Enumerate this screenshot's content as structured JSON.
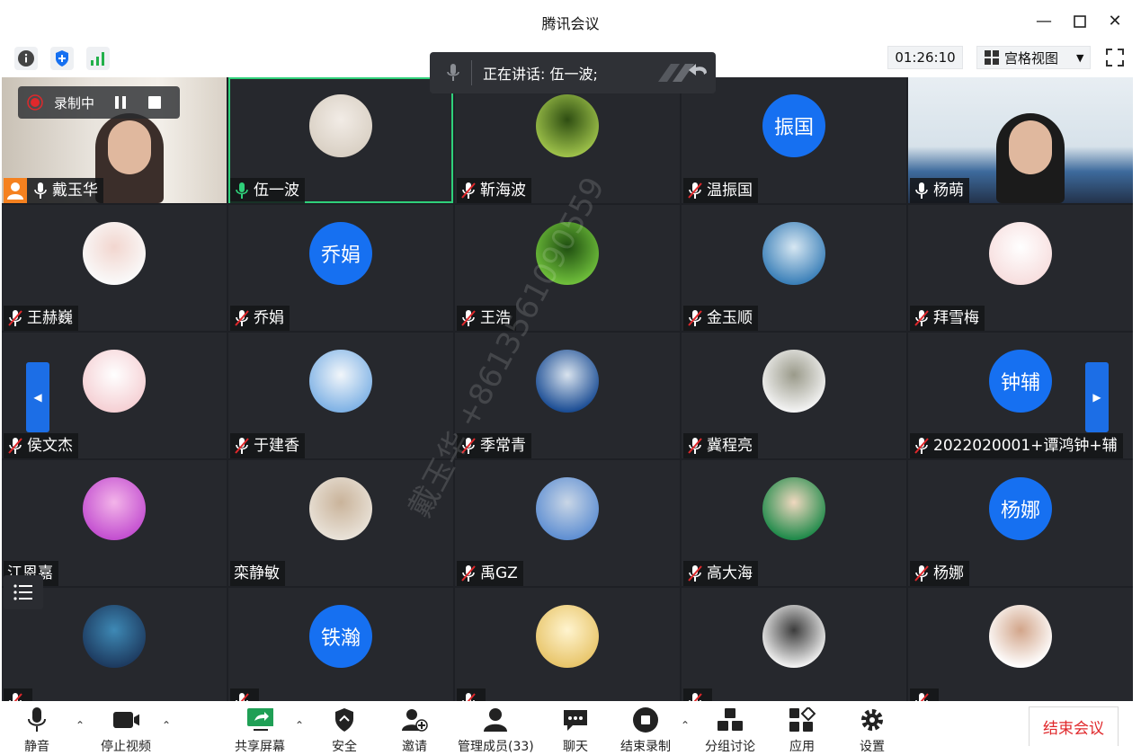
{
  "window": {
    "title": "腾讯会议"
  },
  "toolbar": {
    "timer": "01:26:10",
    "view_mode": "宫格视图"
  },
  "speaking_banner": {
    "text": "正在讲话: 伍一波;"
  },
  "recording": {
    "label": "录制中"
  },
  "watermark": "戴玉华 +8613561090559",
  "participants": [
    {
      "name": "戴玉华",
      "mic": "on"
    },
    {
      "name": "伍一波",
      "mic": "speaking"
    },
    {
      "name": "靳海波",
      "mic": "muted"
    },
    {
      "name": "温振国",
      "mic": "muted",
      "avatar_text": "振国"
    },
    {
      "name": "杨萌",
      "mic": "on"
    },
    {
      "name": "王赫巍",
      "mic": "muted"
    },
    {
      "name": "乔娟",
      "mic": "muted",
      "avatar_text": "乔娟"
    },
    {
      "name": "王浩",
      "mic": "muted"
    },
    {
      "name": "金玉顺",
      "mic": "muted"
    },
    {
      "name": "拜雪梅",
      "mic": "muted"
    },
    {
      "name": "侯文杰",
      "mic": "muted"
    },
    {
      "name": "于建香",
      "mic": "muted"
    },
    {
      "name": "季常青",
      "mic": "muted"
    },
    {
      "name": "冀程亮",
      "mic": "muted"
    },
    {
      "name": "2022020001+谭鸿钟+辅",
      "mic": "muted",
      "avatar_text": "钟辅"
    },
    {
      "name": "江恩嘉",
      "mic": "none"
    },
    {
      "name": "栾静敏",
      "mic": "none"
    },
    {
      "name": "禹GZ",
      "mic": "muted"
    },
    {
      "name": "高大海",
      "mic": "muted"
    },
    {
      "name": "杨娜",
      "mic": "muted",
      "avatar_text": "杨娜"
    },
    {
      "name": "",
      "mic": "muted"
    },
    {
      "name": "",
      "mic": "muted",
      "avatar_text": "铁瀚"
    },
    {
      "name": "",
      "mic": "muted"
    },
    {
      "name": "",
      "mic": "muted"
    },
    {
      "name": "",
      "mic": "muted"
    }
  ],
  "bottombar": {
    "mute": "静音",
    "stop_video": "停止视频",
    "share_screen": "共享屏幕",
    "security": "安全",
    "invite": "邀请",
    "manage_members": "管理成员(33)",
    "chat": "聊天",
    "end_recording": "结束录制",
    "breakout": "分组讨论",
    "apps": "应用",
    "settings": "设置",
    "end_meeting": "结束会议"
  },
  "colors": {
    "accent": "#1670f1",
    "speaking": "#2fd07a",
    "end": "#e0282b"
  }
}
